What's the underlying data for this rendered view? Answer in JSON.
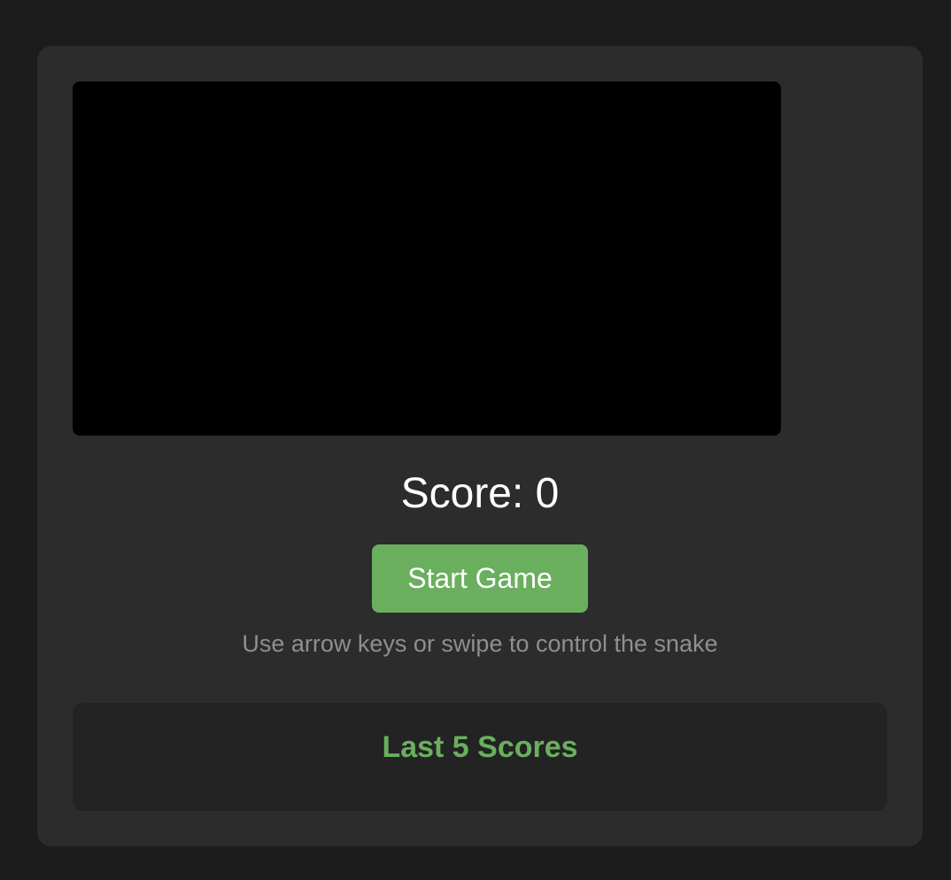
{
  "game": {
    "score_label": "Score: 0",
    "start_button_label": "Start Game",
    "instructions": "Use arrow keys or swipe to control the snake"
  },
  "scores": {
    "title": "Last 5 Scores",
    "entries": []
  },
  "colors": {
    "accent": "#6aaf5e",
    "page_background": "#1c1c1c",
    "panel_background": "#2c2c2c",
    "board_background": "#000000"
  }
}
